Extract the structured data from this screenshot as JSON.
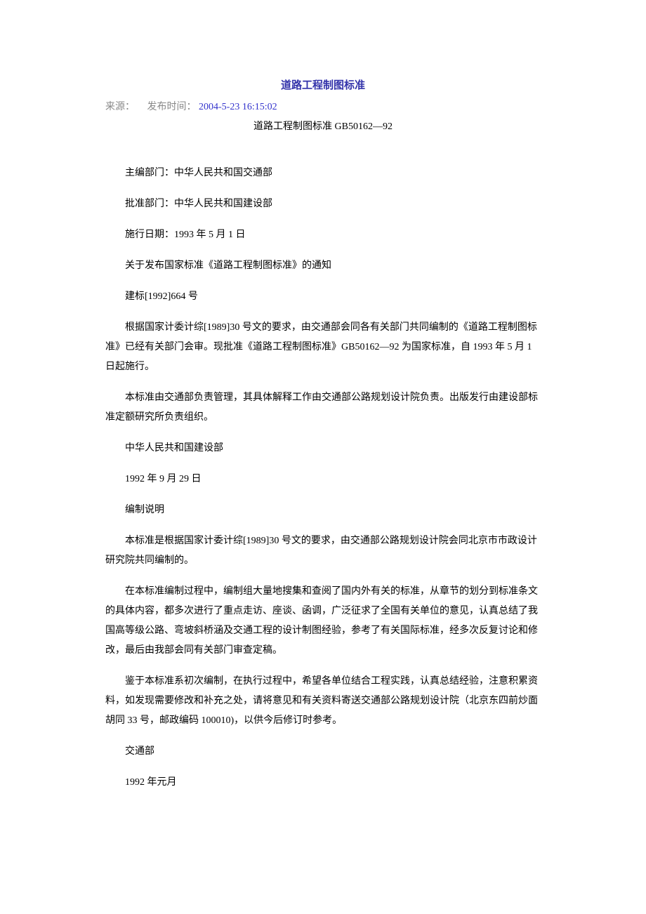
{
  "title": "道路工程制图标准",
  "meta": {
    "source_label": "来源：",
    "pubtime_label": "发布时间：",
    "pubtime_value": "2004-5-23 16:15:02"
  },
  "subtitle": "道路工程制图标准 GB50162—92",
  "paragraphs": [
    "主编部门：中华人民共和国交通部",
    "批准部门：中华人民共和国建设部",
    "施行日期：1993 年 5 月 1 日",
    "关于发布国家标准《道路工程制图标准》的通知",
    "建标[1992]664 号",
    "根据国家计委计综[1989]30 号文的要求，由交通部会同各有关部门共同编制的《道路工程制图标准》已经有关部门会审。现批准《道路工程制图标准》GB50162—92 为国家标准，自 1993 年 5 月 1 日起施行。",
    "本标准由交通部负责管理，其具体解释工作由交通部公路规划设计院负责。出版发行由建设部标准定额研究所负责组织。",
    "中华人民共和国建设部",
    "1992 年 9 月 29 日",
    "编制说明",
    "本标准是根据国家计委计综[1989]30 号文的要求，由交通部公路规划设计院会同北京市市政设计研究院共同编制的。",
    "在本标准编制过程中，编制组大量地搜集和查阅了国内外有关的标准，从章节的划分到标准条文的具体内容，都多次进行了重点走访、座谈、函调，广泛征求了全国有关单位的意见，认真总结了我国高等级公路、弯坡斜桥涵及交通工程的设计制图经验，参考了有关国际标准，经多次反复讨论和修改，最后由我部会同有关部门审查定稿。",
    "鉴于本标准系初次编制，在执行过程中，希望各单位结合工程实践，认真总结经验，注意积累资料，如发现需要修改和补充之处，请将意见和有关资料寄送交通部公路规划设计院（北京东四前炒面胡同 33 号，邮政编码 100010)，以供今后修订时参考。",
    "交通部",
    "1992 年元月"
  ]
}
